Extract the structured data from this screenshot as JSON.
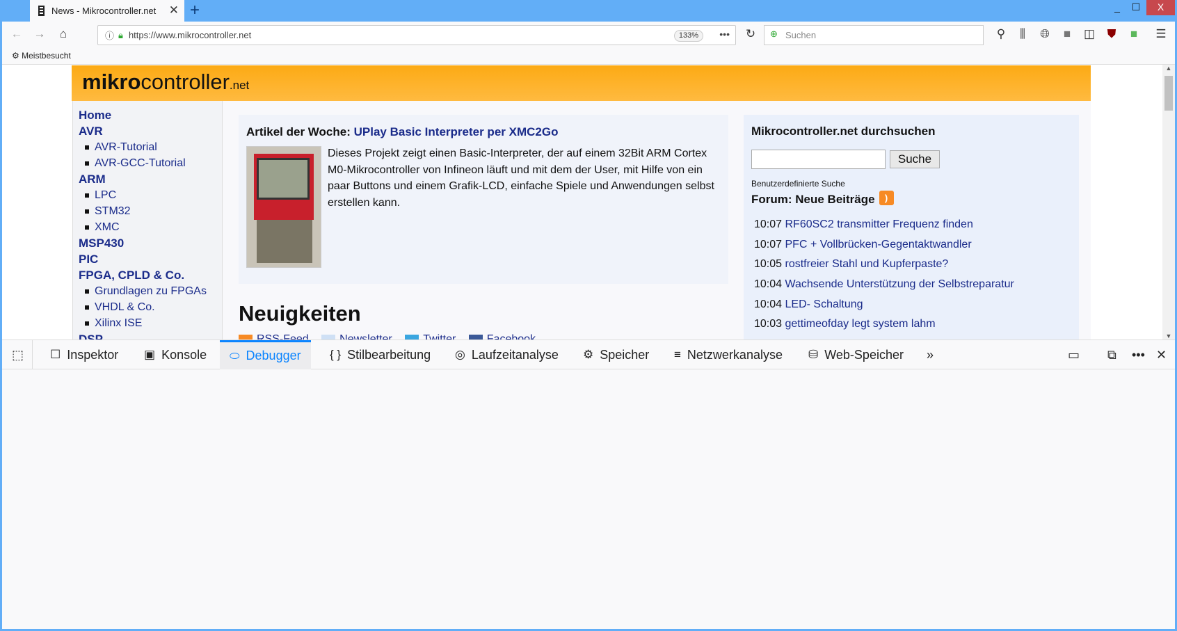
{
  "browser": {
    "tab_title": "News - Mikrocontroller.net",
    "url": "https://www.mikrocontroller.net",
    "zoom": "133%",
    "search_placeholder": "Suchen",
    "bookmark": "Meistbesucht",
    "window_buttons": {
      "min": "_",
      "max": "☐",
      "close": "X"
    }
  },
  "site": {
    "logo_bold": "mikro",
    "logo_rest": "controller",
    "logo_tld": ".net",
    "sidebar": [
      {
        "label": "Home",
        "type": "h"
      },
      {
        "label": "AVR",
        "type": "h"
      },
      {
        "label": "AVR-Tutorial",
        "type": "i"
      },
      {
        "label": "AVR-GCC-Tutorial",
        "type": "i"
      },
      {
        "label": "ARM",
        "type": "h"
      },
      {
        "label": "LPC",
        "type": "i"
      },
      {
        "label": "STM32",
        "type": "i"
      },
      {
        "label": "XMC",
        "type": "i"
      },
      {
        "label": "MSP430",
        "type": "h"
      },
      {
        "label": "PIC",
        "type": "h"
      },
      {
        "label": "FPGA, CPLD & Co.",
        "type": "h"
      },
      {
        "label": "Grundlagen zu FPGAs",
        "type": "i"
      },
      {
        "label": "VHDL & Co.",
        "type": "i"
      },
      {
        "label": "Xilinx ISE",
        "type": "i"
      },
      {
        "label": "DSP",
        "type": "h"
      }
    ],
    "article": {
      "prefix": "Artikel der Woche: ",
      "title": "UPlay Basic Interpreter per XMC2Go",
      "text": "Dieses Projekt zeigt einen Basic-Interpreter, der auf einem 32Bit ARM Cortex M0-Mikrocontroller von Infineon läuft und mit dem der User, mit Hilfe von ein paar Buttons und einem Grafik-LCD, einfache Spiele und Anwendungen selbst erstellen kann."
    },
    "news_heading": "Neuigkeiten",
    "social": [
      "RSS-Feed",
      "Newsletter",
      "Twitter",
      "Facebook"
    ],
    "search": {
      "heading": "Mikrocontroller.net durchsuchen",
      "button": "Suche",
      "caption": "Benutzerdefinierte Suche"
    },
    "forum": {
      "heading": "Forum: Neue Beiträge",
      "posts": [
        {
          "time": "10:07",
          "title": "RF60SC2 transmitter Frequenz finden"
        },
        {
          "time": "10:07",
          "title": "PFC + Vollbrücken-Gegentaktwandler"
        },
        {
          "time": "10:05",
          "title": "rostfreier Stahl und Kupferpaste?"
        },
        {
          "time": "10:04",
          "title": "Wachsende Unterstützung der Selbstreparatur"
        },
        {
          "time": "10:04",
          "title": "LED- Schaltung"
        },
        {
          "time": "10:03",
          "title": "gettimeofday legt system lahm"
        }
      ]
    }
  },
  "devtools": {
    "tabs": [
      "Inspektor",
      "Konsole",
      "Debugger",
      "Stilbearbeitung",
      "Laufzeitanalyse",
      "Speicher",
      "Netzwerkanalyse",
      "Web-Speicher"
    ],
    "selected": "Debugger"
  }
}
